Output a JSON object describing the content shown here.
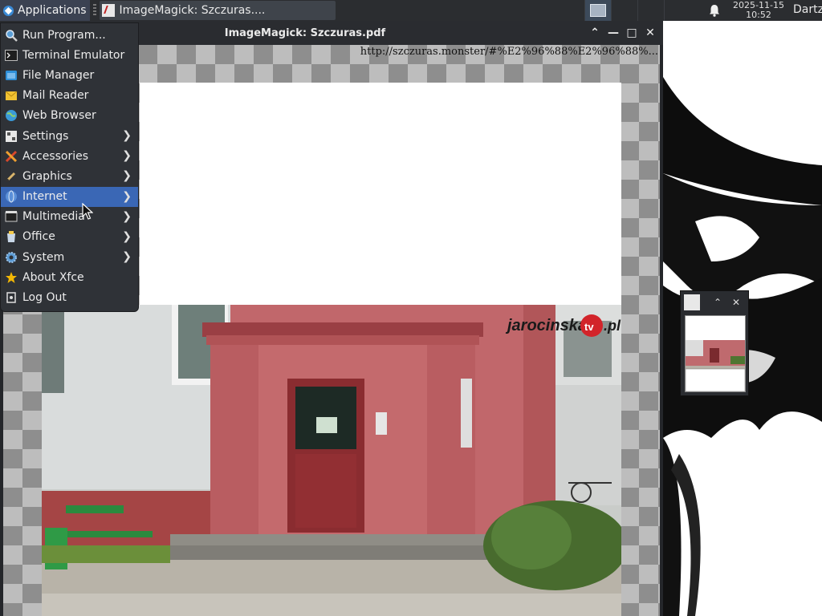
{
  "panel": {
    "applications_label": "Applications",
    "task_title": "ImageMagick: Szczuras....",
    "clock_date": "2025-11-15",
    "clock_time": "10:52",
    "user_label": "Dartz"
  },
  "window": {
    "title": "ImageMagick: Szczuras.pdf",
    "url_text": "http://szczuras.monster/#%E2%96%88%E2%96%88%...",
    "photo_watermark": "jarocinska tv .pl"
  },
  "menu": {
    "items": [
      {
        "label": "Run Program...",
        "icon": "search-icon",
        "submenu": false
      },
      {
        "label": "Terminal Emulator",
        "icon": "terminal-icon",
        "submenu": false
      },
      {
        "label": "File Manager",
        "icon": "folder-icon",
        "submenu": false
      },
      {
        "label": "Mail Reader",
        "icon": "mail-icon",
        "submenu": false
      },
      {
        "label": "Web Browser",
        "icon": "globe-icon",
        "submenu": false
      },
      {
        "label": "Settings",
        "icon": "settings-icon",
        "submenu": true
      },
      {
        "label": "Accessories",
        "icon": "accessories-icon",
        "submenu": true
      },
      {
        "label": "Graphics",
        "icon": "graphics-icon",
        "submenu": true
      },
      {
        "label": "Internet",
        "icon": "internet-icon",
        "submenu": true,
        "selected": true
      },
      {
        "label": "Multimedia",
        "icon": "multimedia-icon",
        "submenu": true
      },
      {
        "label": "Office",
        "icon": "office-icon",
        "submenu": true
      },
      {
        "label": "System",
        "icon": "gear-icon",
        "submenu": true
      },
      {
        "label": "About Xfce",
        "icon": "star-icon",
        "submenu": false
      },
      {
        "label": "Log Out",
        "icon": "logout-icon",
        "submenu": false
      }
    ]
  },
  "colors": {
    "panel_bg": "#2b2d30",
    "menu_bg": "#2f3237",
    "menu_selected": "#3a67b5",
    "building_red": "#b5555a"
  }
}
